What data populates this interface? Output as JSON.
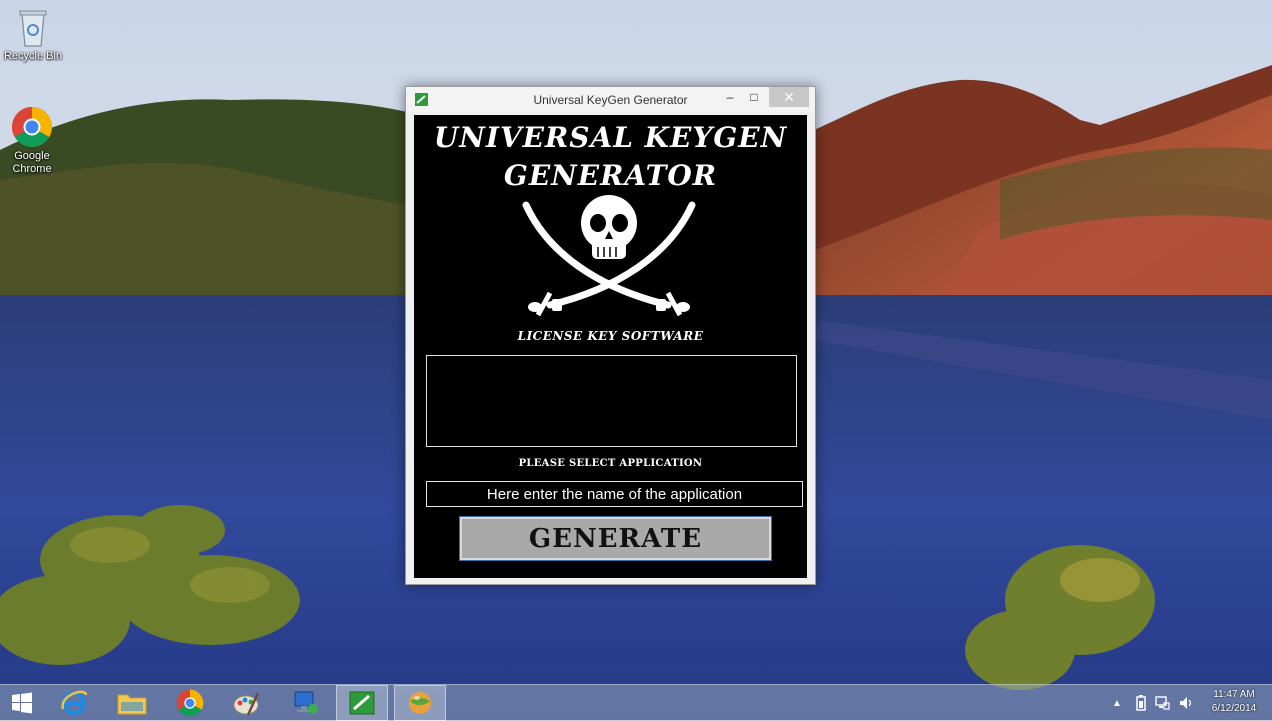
{
  "desktop": {
    "icons": [
      {
        "label": "Recycle Bin",
        "icon": "recycle-bin-icon"
      },
      {
        "label": "Google Chrome",
        "icon": "chrome-icon"
      }
    ]
  },
  "window": {
    "title": "Universal KeyGen Generator",
    "controls": {
      "minimize": "–",
      "maximize": "□",
      "close": "✕"
    },
    "logo": {
      "title_line1": "UNIVERSAL KEYGEN",
      "title_line2": "GENERATOR",
      "tagline": "LICENSE KEY SOFTWARE",
      "image": "skull-crossed-swords-icon"
    },
    "output": {
      "value": ""
    },
    "select_label": "PLEASE SELECT APPLICATION",
    "app_input": {
      "placeholder": "Here enter the name of the application",
      "value": ""
    },
    "generate_label": "GENERATE"
  },
  "taskbar": {
    "items": [
      {
        "name": "start-button",
        "icon": "windows-logo-icon"
      },
      {
        "name": "internet-explorer",
        "icon": "internet-explorer-icon"
      },
      {
        "name": "file-explorer",
        "icon": "folder-icon"
      },
      {
        "name": "chrome",
        "icon": "chrome-icon"
      },
      {
        "name": "paint",
        "icon": "paint-icon"
      },
      {
        "name": "network-app",
        "icon": "computer-network-icon"
      },
      {
        "name": "keygen-app",
        "icon": "keygen-icon",
        "active": true
      },
      {
        "name": "ball-app",
        "icon": "globe-ball-icon",
        "active": true
      }
    ],
    "tray": {
      "icons": [
        "chevron-up-icon",
        "battery-icon",
        "network-icon",
        "volume-icon"
      ],
      "time": "11:47 AM",
      "date": "6/12/2014"
    }
  },
  "colors": {
    "window_bg": "#f0f0f0",
    "client_bg": "#000000",
    "generate_button": "#a9a9a9",
    "close_button": "#c7c7c7",
    "taskbar": "#96a5b9"
  }
}
